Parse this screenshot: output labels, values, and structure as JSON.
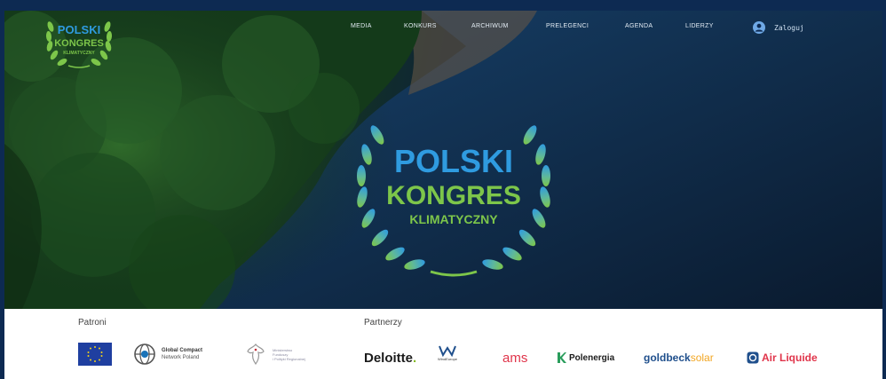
{
  "nav": {
    "items": [
      {
        "id": "media",
        "label": "MEDIA"
      },
      {
        "id": "konkurs",
        "label": "KONKURS"
      },
      {
        "id": "archiwum",
        "label": "ARCHIWUM"
      },
      {
        "id": "prelegenci",
        "label": "PRELEGENCI"
      },
      {
        "id": "agenda",
        "label": "AGENDA"
      },
      {
        "id": "liderzy",
        "label": "LIDERZY"
      }
    ],
    "login_label": "Zaloguj"
  },
  "logo": {
    "line1": "POLSKI",
    "line2": "KONGRES",
    "line3": "KLIMATYCZNY",
    "blue": "#2f9be0",
    "green": "#7dc64a"
  },
  "patrons": {
    "title": "Patroni",
    "global_compact_line1": "Global Compact",
    "global_compact_line2": "Network Poland",
    "ministry_line1": "Ministerstwo",
    "ministry_line2": "Funduszy",
    "ministry_line3": "i Polityki Regionalnej"
  },
  "partners": {
    "title": "Partnerzy",
    "deloitte": "Deloitte",
    "deloitte_dot": ".",
    "windeurope": "WindEurope",
    "ams": "ams",
    "polenergia": "Polenergia",
    "goldbeck": "goldbeck",
    "goldbeck_solar": "solar",
    "airliquide": "Air Liquide"
  },
  "colors": {
    "frame": "#0d2a52",
    "nav_text": "#e3ecf4",
    "deloitte_green": "#86bc25",
    "ams_red": "#e0344a",
    "goldbeck_blue": "#1f4f8c",
    "goldbeck_orange": "#f2a623"
  }
}
